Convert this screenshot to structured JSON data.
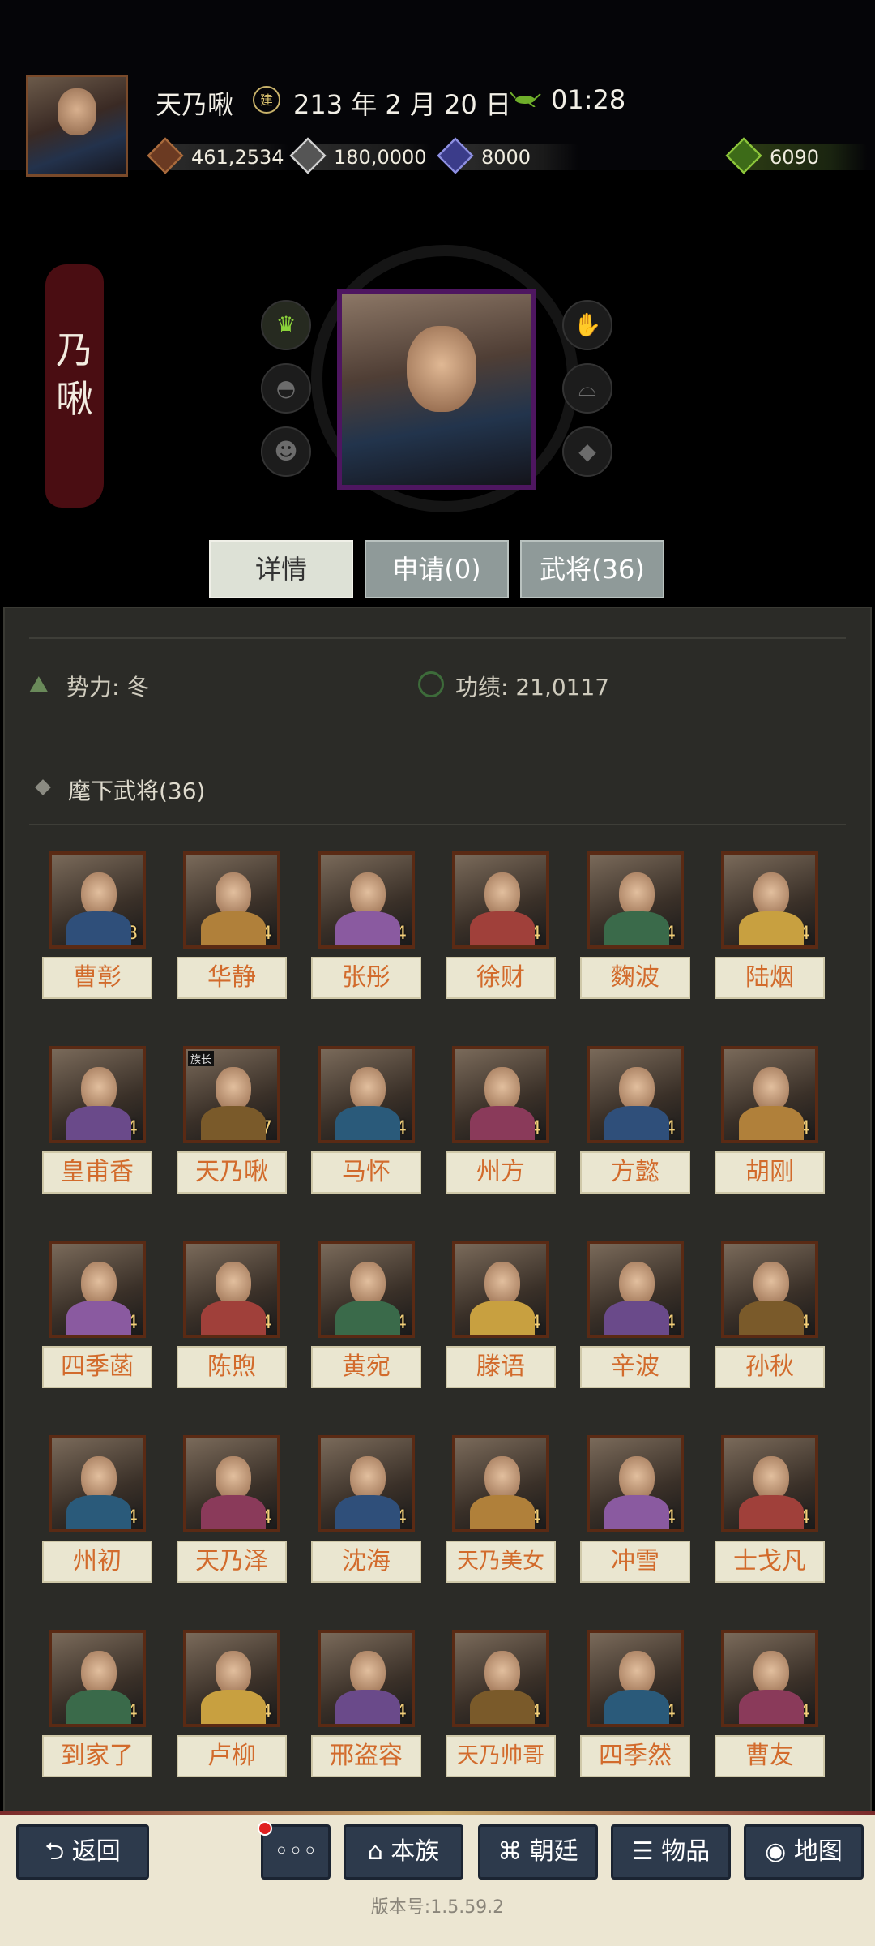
{
  "header": {
    "player_name": "天乃啾",
    "calendar_icon": "era-calendar-icon",
    "date": "213 年 2 月 20 日",
    "time_icon": "cricket-icon",
    "time": "01:28"
  },
  "resources": {
    "coin": "461,2534",
    "food": "180,0000",
    "troops": "8000",
    "gold": "6090"
  },
  "name_banner": "乃\n啾",
  "tabs": {
    "details": "详情",
    "apply": "申请(0)",
    "generals": "武将(36)"
  },
  "info": {
    "faction": "势力: 冬",
    "merit": "功绩: 21,0117"
  },
  "roster": {
    "title": "麾下武将(36)",
    "generals": [
      {
        "name": "曹彰",
        "cost": "8"
      },
      {
        "name": "华静",
        "cost": "4"
      },
      {
        "name": "张彤",
        "cost": "4"
      },
      {
        "name": "徐财",
        "cost": "4"
      },
      {
        "name": "麴波",
        "cost": "4"
      },
      {
        "name": "陆烟",
        "cost": "4"
      },
      {
        "name": "皇甫香",
        "cost": "COST 4"
      },
      {
        "name": "天乃啾",
        "cost": "COST 7",
        "badge": "族长"
      },
      {
        "name": "马怀",
        "cost": "COST 4"
      },
      {
        "name": "州方",
        "cost": "4"
      },
      {
        "name": "方懿",
        "cost": "4"
      },
      {
        "name": "胡刚",
        "cost": "COST 4"
      },
      {
        "name": "四季菡",
        "cost": "4"
      },
      {
        "name": "陈煦",
        "cost": "COST 4"
      },
      {
        "name": "黄宛",
        "cost": "COST 4"
      },
      {
        "name": "滕语",
        "cost": "4"
      },
      {
        "name": "辛波",
        "cost": "4"
      },
      {
        "name": "孙秋",
        "cost": "4"
      },
      {
        "name": "州初",
        "cost": "COST 4"
      },
      {
        "name": "天乃泽",
        "cost": "COST 4"
      },
      {
        "name": "沈海",
        "cost": "4"
      },
      {
        "name": "天乃美女",
        "cost": "COST 4"
      },
      {
        "name": "冲雪",
        "cost": "COST 4"
      },
      {
        "name": "士戈凡",
        "cost": "4"
      },
      {
        "name": "到家了",
        "cost": "COST 4"
      },
      {
        "name": "卢柳",
        "cost": "COST 4"
      },
      {
        "name": "邢盗容",
        "cost": "COST 4"
      },
      {
        "name": "天乃帅哥",
        "cost": "COST 4"
      },
      {
        "name": "四季然",
        "cost": "COST 4"
      },
      {
        "name": "曹友",
        "cost": "4"
      }
    ]
  },
  "nav": {
    "back": "返回",
    "more": "◦◦◦",
    "clan": "本族",
    "court": "朝廷",
    "items": "物品",
    "map": "地图"
  },
  "version": "版本号:1.5.59.2",
  "colors": {
    "accent_orange": "#d26b2c",
    "panel_bg": "#2b2b27",
    "banner_red": "#4a0d12",
    "crown_green": "#8bd23a"
  }
}
